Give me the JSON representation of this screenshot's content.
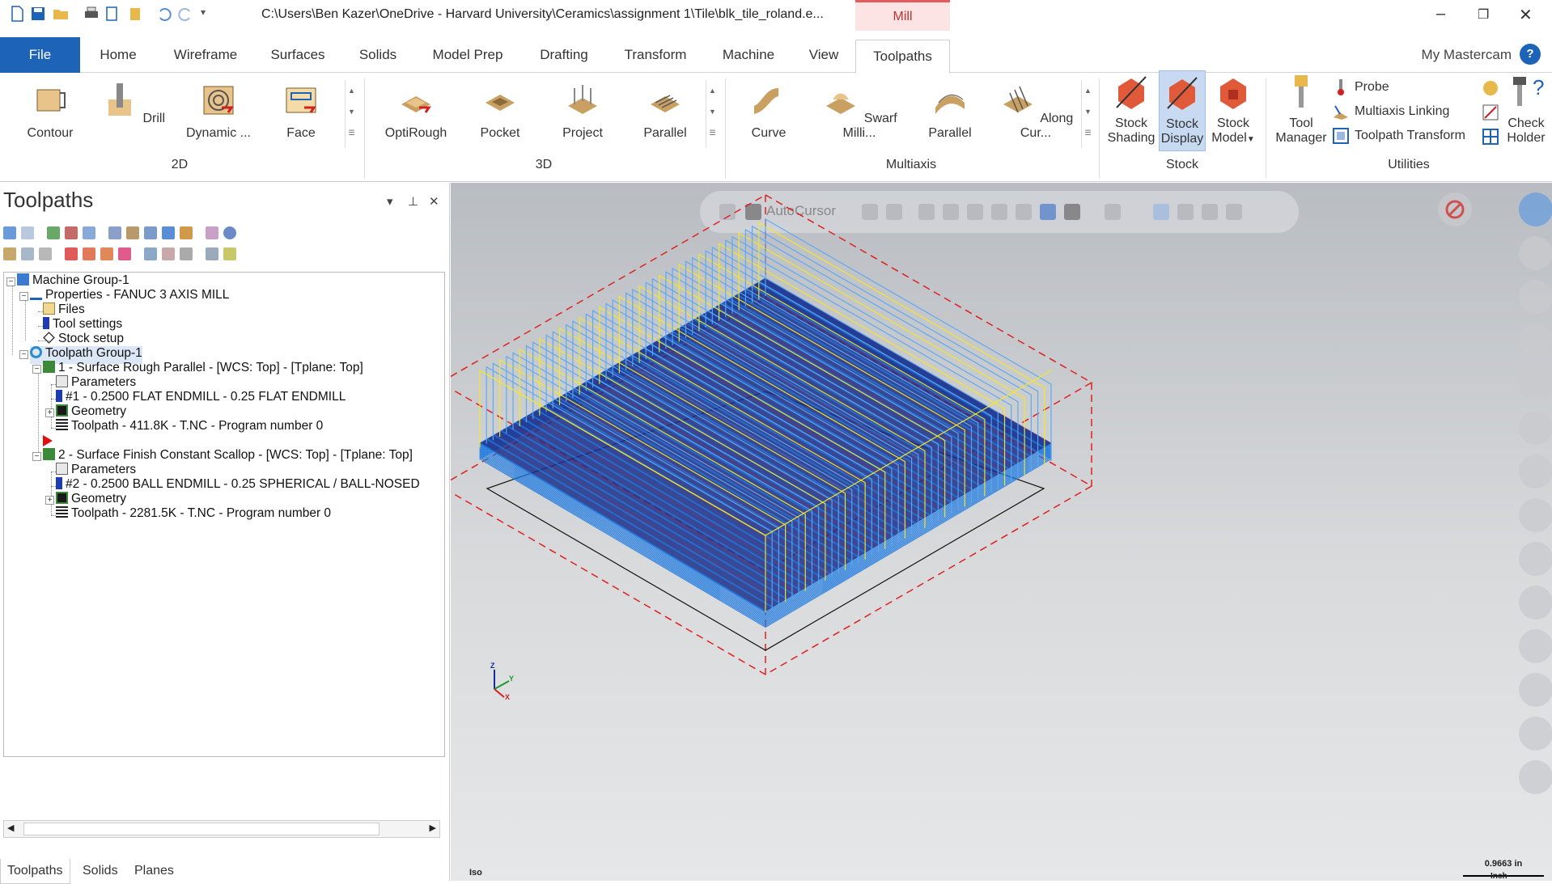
{
  "title_bar": {
    "path": "C:\\Users\\Ben Kazer\\OneDrive - Harvard University\\Ceramics\\assignment 1\\Tile\\blk_tile_roland.e...",
    "context_tab": "Mill"
  },
  "menu": {
    "file": "File",
    "tabs": [
      "Home",
      "Wireframe",
      "Surfaces",
      "Solids",
      "Model Prep",
      "Drafting",
      "Transform",
      "Machine",
      "View",
      "Toolpaths"
    ],
    "active_tab": "Toolpaths",
    "my_mastercam": "My Mastercam",
    "help": "?"
  },
  "ribbon": {
    "groups": {
      "g2d": "2D",
      "g3d": "3D",
      "multiaxis": "Multiaxis",
      "stock": "Stock",
      "utilities": "Utilities"
    },
    "buttons_2d": [
      "Contour",
      "Drill",
      "Dynamic ...",
      "Face"
    ],
    "buttons_3d": [
      "OptiRough",
      "Pocket",
      "Project",
      "Parallel"
    ],
    "buttons_multiaxis": [
      "Curve",
      "Swarf Milli...",
      "Parallel",
      "Along Cur..."
    ],
    "stock": {
      "shading": [
        "Stock",
        "Shading"
      ],
      "display": [
        "Stock",
        "Display"
      ],
      "model": [
        "Stock",
        "Model"
      ]
    },
    "utilities": {
      "tool_manager": [
        "Tool",
        "Manager"
      ],
      "probe": "Probe",
      "multiaxis_linking": "Multiaxis Linking",
      "toolpath_transform": "Toolpath Transform",
      "check_holder": [
        "Check",
        "Holder"
      ]
    }
  },
  "panel": {
    "title": "Toolpaths",
    "tree": {
      "machine_group": "Machine Group-1",
      "properties": "Properties - FANUC 3 AXIS MILL",
      "files": "Files",
      "tool_settings": "Tool settings",
      "stock_setup": "Stock setup",
      "toolpath_group": "Toolpath Group-1",
      "op1": {
        "name": "1 - Surface Rough Parallel - [WCS: Top] - [Tplane: Top]",
        "parameters": "Parameters",
        "tool": "#1 - 0.2500 FLAT ENDMILL - 0.25 FLAT ENDMILL",
        "geometry": "Geometry",
        "toolpath": "Toolpath - 411.8K - T.NC - Program number 0"
      },
      "op2": {
        "name": "2 - Surface Finish Constant Scallop - [WCS: Top] - [Tplane: Top]",
        "parameters": "Parameters",
        "tool": "#2 - 0.2500 BALL ENDMILL - 0.25 SPHERICAL / BALL-NOSED",
        "geometry": "Geometry",
        "toolpath": "Toolpath - 2281.5K - T.NC - Program number 0"
      }
    },
    "bottom_tabs": [
      "Toolpaths",
      "Solids",
      "Planes"
    ]
  },
  "viewport": {
    "autocursor": "AutoCursor",
    "view_name": "Iso",
    "scale_value": "0.9663 in",
    "scale_unit": "Inch",
    "axes": {
      "x": "X",
      "y": "Y",
      "z": "Z"
    }
  },
  "colors": {
    "accent": "#1d63b7",
    "rough_path": "#f0e92a",
    "finish_path": "#1f7ae0",
    "stock_box": "#e02020"
  }
}
